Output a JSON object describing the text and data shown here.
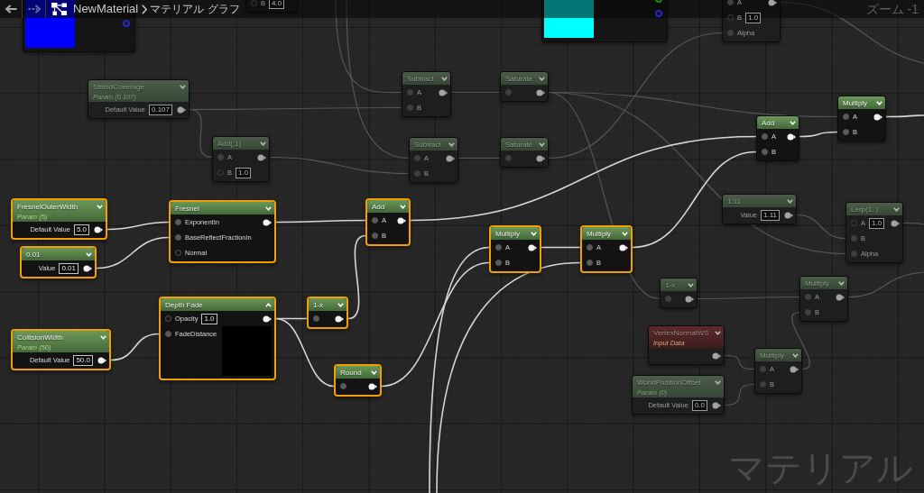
{
  "toolbar": {
    "nav": [
      {
        "kind": "back",
        "disabled": false
      },
      {
        "kind": "forward",
        "disabled": true
      }
    ],
    "breadcrumb": [
      "NewMaterial",
      "マテリアル グラフ"
    ],
    "zoom": "ズーム -1"
  },
  "graph": {
    "nodes": [
      {
        "kind": "color_preview",
        "color": "#0000ff",
        "outputs": [
          {
            "color": "#2626c8"
          }
        ],
        "selected": false
      },
      {
        "kind": "partial",
        "inputs": [
          {
            "label": "B",
            "value": "4.0",
            "connected": false
          }
        ],
        "output": false,
        "selected": false,
        "dimmed": true
      },
      {
        "kind": "color_preview",
        "color": "#00ffff",
        "outputs": [
          {
            "color": "#1e8a1e"
          },
          {
            "color": "#2626c8"
          }
        ],
        "selected": false
      },
      {
        "kind": "partial",
        "inputs": [
          {
            "label": "A",
            "connected": true
          },
          {
            "label": "B",
            "value": "1.0",
            "connected": false
          },
          {
            "label": "Alpha",
            "connected": true
          }
        ],
        "output": true,
        "selected": false,
        "dimmed": true
      },
      {
        "kind": "parameter",
        "title": "ShieldCoverage",
        "subtitle": "Param (0.107)",
        "expanded": false,
        "properties": [
          {
            "label": "Default Value",
            "value": "0.107"
          }
        ],
        "output": true,
        "selected": false,
        "dimmed": true
      },
      {
        "kind": "expression",
        "title": "Subtract",
        "expanded": false,
        "inputs": [
          {
            "label": "A",
            "connected": true
          },
          {
            "label": "B",
            "connected": true
          }
        ],
        "output": true,
        "selected": false,
        "dimmed": true
      },
      {
        "kind": "expression",
        "title": "Saturate",
        "expanded": false,
        "inputs": [
          {
            "connected": true
          }
        ],
        "output": true,
        "selected": false,
        "dimmed": true
      },
      {
        "kind": "expression",
        "title": "Add(,1)",
        "expanded": false,
        "inputs": [
          {
            "label": "A",
            "connected": true
          },
          {
            "label": "B",
            "value": "1.0",
            "connected": false
          }
        ],
        "output": true,
        "selected": false,
        "dimmed": true
      },
      {
        "kind": "expression",
        "title": "Subtract",
        "expanded": false,
        "inputs": [
          {
            "label": "A",
            "connected": true
          },
          {
            "label": "B",
            "connected": true
          }
        ],
        "output": true,
        "selected": false,
        "dimmed": true
      },
      {
        "kind": "expression",
        "title": "Saturate",
        "expanded": false,
        "inputs": [
          {
            "connected": true
          }
        ],
        "output": true,
        "selected": false,
        "dimmed": true
      },
      {
        "kind": "expression",
        "title": "Add",
        "expanded": false,
        "inputs": [
          {
            "label": "A",
            "connected": true
          },
          {
            "label": "B",
            "connected": true
          }
        ],
        "output": true,
        "selected": false,
        "dimmed": false
      },
      {
        "kind": "expression",
        "title": "Multiply",
        "expanded": false,
        "inputs": [
          {
            "label": "A",
            "connected": true
          },
          {
            "label": "B",
            "connected": true
          }
        ],
        "output": true,
        "selected": false,
        "dimmed": false
      },
      {
        "kind": "parameter",
        "title": "FresnelOuterWidth",
        "subtitle": "Param (5)",
        "expanded": false,
        "properties": [
          {
            "label": "Default Value",
            "value": "5.0"
          }
        ],
        "output": true,
        "selected": true,
        "dimmed": false
      },
      {
        "kind": "expression",
        "title": "0.01",
        "expanded": false,
        "properties": [
          {
            "label": "Value",
            "value": "0.01"
          }
        ],
        "output": true,
        "selected": true,
        "dimmed": false
      },
      {
        "kind": "expression",
        "title": "Fresnel",
        "expanded": false,
        "inputs": [
          {
            "label": "ExponentIn",
            "connected": true
          },
          {
            "label": "BaseReflectFractionIn",
            "connected": true
          },
          {
            "label": "Normal",
            "connected": false
          }
        ],
        "output": true,
        "selected": true,
        "dimmed": false
      },
      {
        "kind": "expression",
        "title": "Add",
        "expanded": false,
        "inputs": [
          {
            "label": "A",
            "connected": true
          },
          {
            "label": "B",
            "connected": true
          }
        ],
        "output": true,
        "selected": true,
        "dimmed": false
      },
      {
        "kind": "expression",
        "title": "Multiply",
        "expanded": false,
        "inputs": [
          {
            "label": "A",
            "connected": true
          },
          {
            "label": "B",
            "connected": true
          }
        ],
        "output": true,
        "selected": true,
        "dimmed": false
      },
      {
        "kind": "expression",
        "title": "Multiply",
        "expanded": false,
        "inputs": [
          {
            "label": "A",
            "connected": true
          },
          {
            "label": "B",
            "connected": true
          }
        ],
        "output": true,
        "selected": true,
        "dimmed": false
      },
      {
        "kind": "expression",
        "title": "1.11",
        "expanded": false,
        "properties": [
          {
            "label": "Value",
            "value": "1.11"
          }
        ],
        "output": true,
        "selected": false,
        "dimmed": true
      },
      {
        "kind": "expression",
        "title": "Lerp(1..)",
        "expanded": false,
        "inputs": [
          {
            "label": "A",
            "value": "1.0",
            "connected": false
          },
          {
            "label": "B",
            "connected": true
          },
          {
            "label": "Alpha",
            "connected": true
          }
        ],
        "output": true,
        "selected": false,
        "dimmed": true
      },
      {
        "kind": "expression",
        "title": "Depth Fade",
        "expanded": true,
        "inputs": [
          {
            "label": "Opacity",
            "value": "1.0",
            "connected": false
          },
          {
            "label": "FadeDistance",
            "connected": true
          }
        ],
        "output": true,
        "selected": true,
        "dimmed": false
      },
      {
        "kind": "expression",
        "title": "1-x",
        "expanded": false,
        "inputs": [
          {
            "connected": true
          }
        ],
        "output": true,
        "selected": true,
        "dimmed": false
      },
      {
        "kind": "expression",
        "title": "1-x",
        "expanded": false,
        "inputs": [
          {
            "connected": true
          }
        ],
        "output": true,
        "selected": false,
        "dimmed": true
      },
      {
        "kind": "expression",
        "title": "Multiply",
        "expanded": false,
        "inputs": [
          {
            "label": "A",
            "connected": true
          },
          {
            "label": "B",
            "connected": true
          }
        ],
        "output": true,
        "selected": false,
        "dimmed": true
      },
      {
        "kind": "parameter",
        "title": "CollisionWidth",
        "subtitle": "Param (50)",
        "expanded": false,
        "properties": [
          {
            "label": "Default Value",
            "value": "50.0"
          }
        ],
        "output": true,
        "selected": true,
        "dimmed": false
      },
      {
        "kind": "input",
        "title": "VertexNormalWS",
        "subtitle": "Input Data",
        "expanded": false,
        "output": true,
        "selected": false,
        "dimmed": true
      },
      {
        "kind": "expression",
        "title": "Round",
        "expanded": false,
        "inputs": [
          {
            "connected": true
          }
        ],
        "output": true,
        "selected": true,
        "dimmed": false
      },
      {
        "kind": "parameter",
        "title": "WorldPositionOffset",
        "subtitle": "Param (0)",
        "expanded": false,
        "properties": [
          {
            "label": "Default Value",
            "value": "0.0"
          }
        ],
        "output": true,
        "selected": false,
        "dimmed": true
      },
      {
        "kind": "expression",
        "title": "Multiply",
        "expanded": false,
        "inputs": [
          {
            "label": "A",
            "connected": true
          },
          {
            "label": "B",
            "connected": true
          }
        ],
        "output": true,
        "selected": false,
        "dimmed": true
      }
    ],
    "corner_label": "マテリアル"
  }
}
